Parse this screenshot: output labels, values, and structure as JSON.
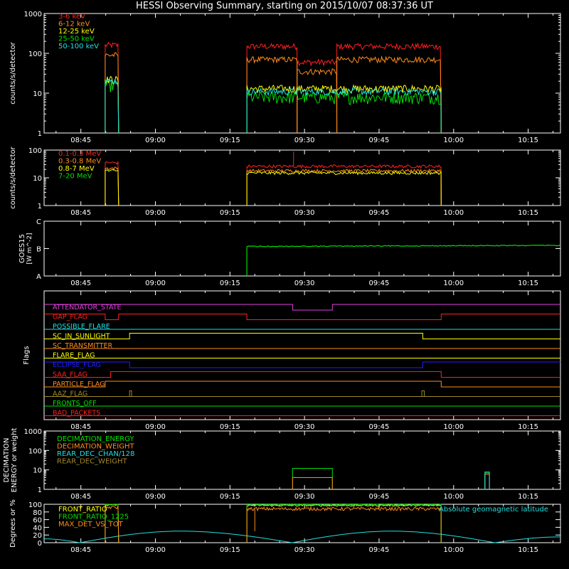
{
  "title": "HESSI Observing Summary, starting on 2015/10/07 08:37:36 UT",
  "time_ticks": [
    "08:45",
    "09:00",
    "09:15",
    "09:30",
    "09:45",
    "10:00",
    "10:15"
  ],
  "time_tick_minutes": [
    525,
    540,
    555,
    570,
    585,
    600,
    615
  ],
  "xlim_minutes": [
    517.6,
    621.5
  ],
  "colors": {
    "red": "#ff2020",
    "orange": "#ff8c1a",
    "yellow": "#ffff00",
    "green": "#00e000",
    "cyan": "#20e0e0",
    "magenta": "#e040e0",
    "blue": "#2020ff",
    "olive": "#a08828",
    "frame": "#ffffff"
  },
  "chart_data": [
    {
      "id": "low-energy",
      "type": "line",
      "ylabel": "counts/s/detector",
      "yscale": "log",
      "ylim": [
        1,
        1000
      ],
      "yticks": [
        "1",
        "10",
        "100",
        "1000"
      ],
      "legend_position": "top-left",
      "intervals_minutes": [
        [
          529.9,
          532.6
        ],
        [
          558.4,
          597.5
        ]
      ],
      "series": [
        {
          "name": "3-6 keV",
          "color": "#ff2020",
          "levels": [
            [
              529.9,
              532.6,
              160
            ],
            [
              558.4,
              568.5,
              150
            ],
            [
              568.5,
              576.5,
              60
            ],
            [
              576.5,
              597.5,
              150
            ]
          ]
        },
        {
          "name": "6-12 keV",
          "color": "#ff8c1a",
          "levels": [
            [
              529.9,
              532.6,
              90
            ],
            [
              558.4,
              568.5,
              70
            ],
            [
              568.5,
              576.5,
              35
            ],
            [
              576.5,
              597.5,
              70
            ]
          ]
        },
        {
          "name": "12-25 keV",
          "color": "#ffff00",
          "levels": [
            [
              529.9,
              532.6,
              22
            ],
            [
              558.4,
              597.5,
              13
            ]
          ]
        },
        {
          "name": "25-50 keV",
          "color": "#00e000",
          "levels": [
            [
              529.9,
              532.6,
              16
            ],
            [
              558.4,
              597.5,
              8
            ]
          ]
        },
        {
          "name": "50-100 keV",
          "color": "#20e0e0",
          "levels": [
            [
              529.9,
              532.6,
              20
            ],
            [
              558.4,
              597.5,
              11
            ]
          ]
        }
      ]
    },
    {
      "id": "high-energy",
      "type": "line",
      "ylabel": "counts/s/detector",
      "yscale": "log",
      "ylim": [
        1,
        100
      ],
      "yticks": [
        "1",
        "10",
        "100"
      ],
      "legend_position": "top-left",
      "series": [
        {
          "name": "0.1-0.3 MeV",
          "color": "#ff2020",
          "levels": [
            [
              529.9,
              532.6,
              35
            ],
            [
              558.4,
              597.5,
              26
            ]
          ]
        },
        {
          "name": "0.3-0.8 MeV",
          "color": "#ff8c1a",
          "levels": [
            [
              529.9,
              532.6,
              22
            ],
            [
              558.4,
              597.5,
              18
            ]
          ]
        },
        {
          "name": "0.8-7 MeV",
          "color": "#ffff00",
          "levels": [
            [
              529.9,
              532.6,
              18
            ],
            [
              558.4,
              597.5,
              15
            ]
          ]
        },
        {
          "name": "7-20 MeV",
          "color": "#00e000",
          "levels": []
        }
      ]
    },
    {
      "id": "goes",
      "type": "line",
      "ylabel": "GOES15",
      "ylabel_unit": "[W m^-2]",
      "yscale": "log",
      "yticks": [
        "A",
        "B",
        "C"
      ],
      "series": [
        {
          "color": "#00e000",
          "start_minute": 558.4,
          "level_class": "B",
          "start_value_class": "B1.1",
          "end_value_class": "B1.3"
        }
      ]
    },
    {
      "id": "flags",
      "type": "step",
      "ylabel": "Flags",
      "flags": [
        {
          "name": "ATTENDATOR_STATE",
          "color": "#e040e0",
          "high_intervals": [
            [
              517.6,
              567.6
            ],
            [
              575.6,
              621.5
            ]
          ],
          "low_intervals": [
            [
              567.6,
              575.6
            ]
          ]
        },
        {
          "name": "GAP_FLAG",
          "color": "#ff2020",
          "high_intervals": [
            [
              517.6,
              529.9
            ],
            [
              532.6,
              558.4
            ],
            [
              597.5,
              621.5
            ]
          ],
          "low_intervals": [
            [
              529.9,
              532.6
            ],
            [
              558.4,
              597.5
            ]
          ]
        },
        {
          "name": "POSSIBLE_FLARE",
          "color": "#20e0e0",
          "high_intervals": [],
          "low_intervals": [
            [
              517.6,
              621.5
            ]
          ]
        },
        {
          "name": "SC_IN_SUNLIGHT",
          "color": "#ffff00",
          "high_intervals": [
            [
              534.8,
              593.8
            ]
          ],
          "low_intervals": [
            [
              517.6,
              534.8
            ],
            [
              593.8,
              621.5
            ]
          ]
        },
        {
          "name": "SC_TRANSMITTER",
          "color": "#ff8c1a",
          "high_intervals": [],
          "low_intervals": [
            [
              517.6,
              621.5
            ]
          ]
        },
        {
          "name": "FLARE_FLAG",
          "color": "#ffff00",
          "high_intervals": [],
          "low_intervals": [
            [
              517.6,
              621.5
            ]
          ]
        },
        {
          "name": "ECLIPSE_FLAG",
          "color": "#2020ff",
          "high_intervals": [
            [
              517.6,
              534.8
            ],
            [
              593.8,
              621.5
            ]
          ],
          "low_intervals": [
            [
              534.8,
              593.8
            ]
          ]
        },
        {
          "name": "SAA_FLAG",
          "color": "#ff2020",
          "high_intervals": [
            [
              531.0,
              597.5
            ]
          ],
          "low_intervals": [
            [
              517.6,
              531.0
            ],
            [
              597.5,
              621.5
            ]
          ]
        },
        {
          "name": "PARTICLE_FLAG",
          "color": "#ff8c1a",
          "high_intervals": [
            [
              529.9,
              597.5
            ]
          ],
          "low_intervals": [
            [
              517.6,
              529.9
            ],
            [
              597.5,
              621.5
            ]
          ]
        },
        {
          "name": "AAZ_FLAG",
          "color": "#a08828",
          "high_intervals": [
            [
              534.8,
              535.2
            ],
            [
              593.6,
              594.1
            ]
          ],
          "low_intervals": [
            [
              517.6,
              621.5
            ]
          ]
        },
        {
          "name": "FRONTS_OFF",
          "color": "#00e000",
          "high_intervals": [],
          "low_intervals": [
            [
              517.6,
              621.5
            ]
          ]
        },
        {
          "name": "BAD_PACKETS",
          "color": "#ff2020",
          "high_intervals": [],
          "low_intervals": [
            [
              517.6,
              621.5
            ]
          ]
        }
      ]
    },
    {
      "id": "decimation",
      "type": "step",
      "ylabel": "DECIMATION ENERGY or weight",
      "yscale": "log",
      "ylim": [
        1,
        1000
      ],
      "yticks": [
        "1",
        "10",
        "100",
        "1000"
      ],
      "legend_position": "top-left",
      "series": [
        {
          "name": "DECIMATION_ENERGY",
          "color": "#00e000",
          "levels": [
            [
              567.6,
              575.6,
              12
            ],
            [
              606.3,
              607.2,
              8
            ]
          ]
        },
        {
          "name": "DECIMATION_WEIGHT",
          "color": "#ff8c1a",
          "levels": [
            [
              567.6,
              575.6,
              4
            ],
            [
              606.3,
              607.2,
              6
            ]
          ]
        },
        {
          "name": "REAR_DEC_CHAN/128",
          "color": "#20e0e0",
          "levels": [
            [
              606.3,
              607.2,
              7
            ]
          ]
        },
        {
          "name": "REAR_DEC_WEIGHT",
          "color": "#a08828",
          "levels": []
        }
      ]
    },
    {
      "id": "ratios",
      "type": "line",
      "ylabel": "Degrees or %",
      "ylim": [
        0,
        100
      ],
      "yticks": [
        "0",
        "20",
        "40",
        "60",
        "80",
        "100"
      ],
      "legend_position": "top-left",
      "annotation": "Absolute geomagnetic latitude",
      "series": [
        {
          "name": "FRONT_RATIO",
          "color": "#ffff00",
          "levels": [
            [
              529.9,
              532.6,
              98
            ],
            [
              558.4,
              597.5,
              97
            ]
          ]
        },
        {
          "name": "FRONT_RATIO_1225",
          "color": "#00e000",
          "levels": [
            [
              529.9,
              532.6,
              100
            ],
            [
              558.4,
              597.5,
              99
            ]
          ]
        },
        {
          "name": "MAX_DET_VS_TOT",
          "color": "#ff8c1a",
          "levels": [
            [
              529.9,
              532.6,
              92
            ],
            [
              558.4,
              597.5,
              88
            ]
          ]
        },
        {
          "name": "Absolute geomagnetic latitude",
          "color": "#20e0e0",
          "x": [
            517.6,
            524.8,
            545.0,
            567.5,
            587.5,
            608.3,
            621.5
          ],
          "y": [
            10,
            0,
            30,
            0,
            30,
            0,
            15
          ]
        }
      ]
    }
  ]
}
